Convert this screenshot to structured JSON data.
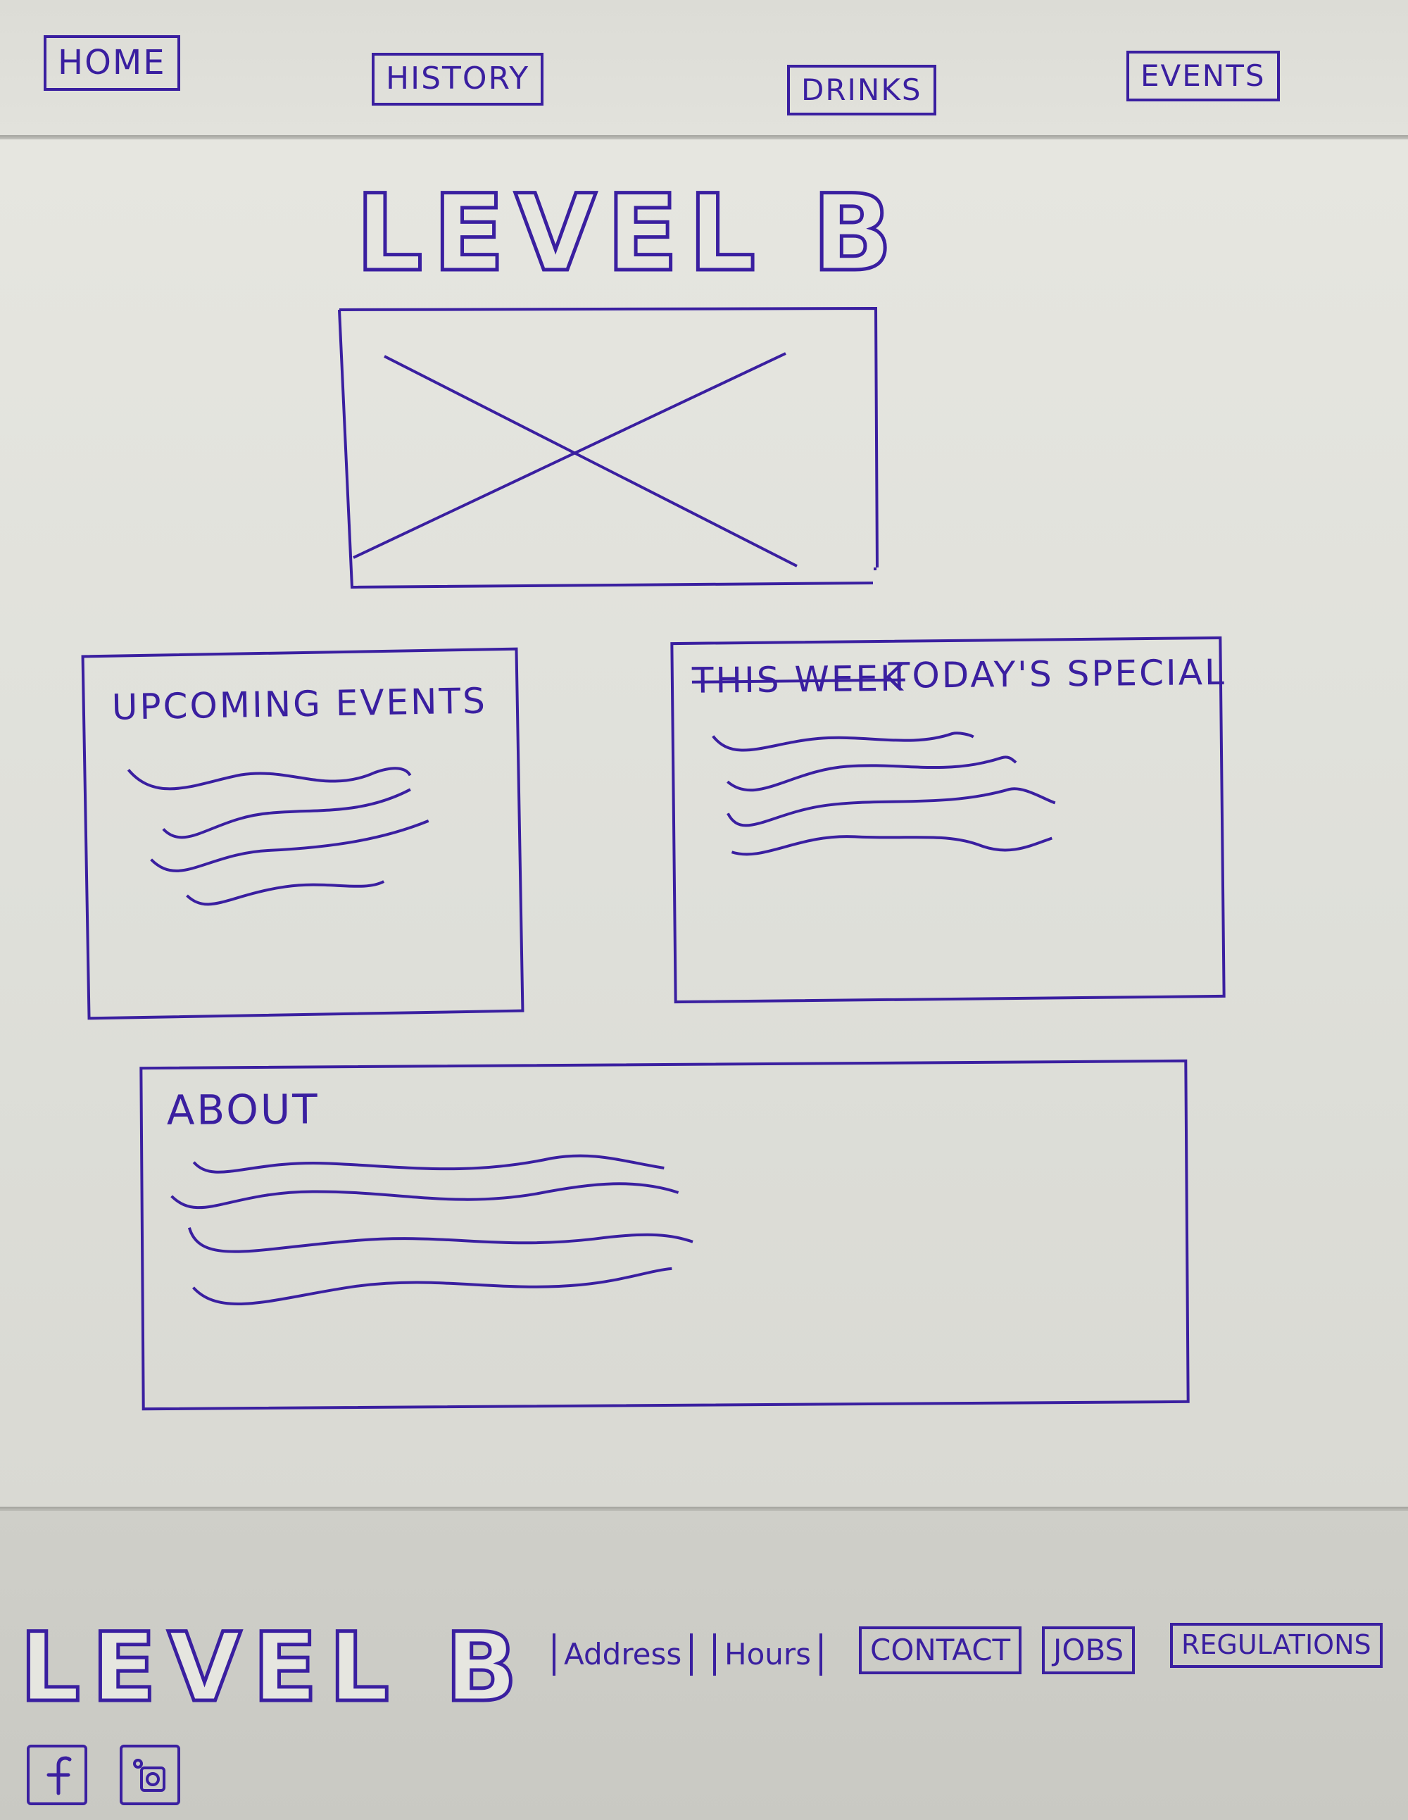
{
  "nav": {
    "items": [
      "HOME",
      "HISTORY",
      "DRINKS",
      "EVENTS"
    ]
  },
  "brand": {
    "logo_text": "LEVEL B"
  },
  "hero": {
    "image_placeholder": "image placeholder"
  },
  "panels": {
    "upcoming_events": {
      "title": "UPCOMING EVENTS"
    },
    "todays_special": {
      "struck_text": "THIS WEEK",
      "title": "TODAY'S SPECIAL"
    },
    "about": {
      "title": "ABOUT"
    }
  },
  "footer": {
    "logo_text": "LEVEL B",
    "links": [
      "Address",
      "Hours",
      "CONTACT",
      "JOBS",
      "REGULATIONS"
    ],
    "social": [
      "facebook-icon",
      "instagram-icon"
    ]
  },
  "colors": {
    "ink": "#3a1fa0",
    "paper": "#e6e6e0"
  }
}
